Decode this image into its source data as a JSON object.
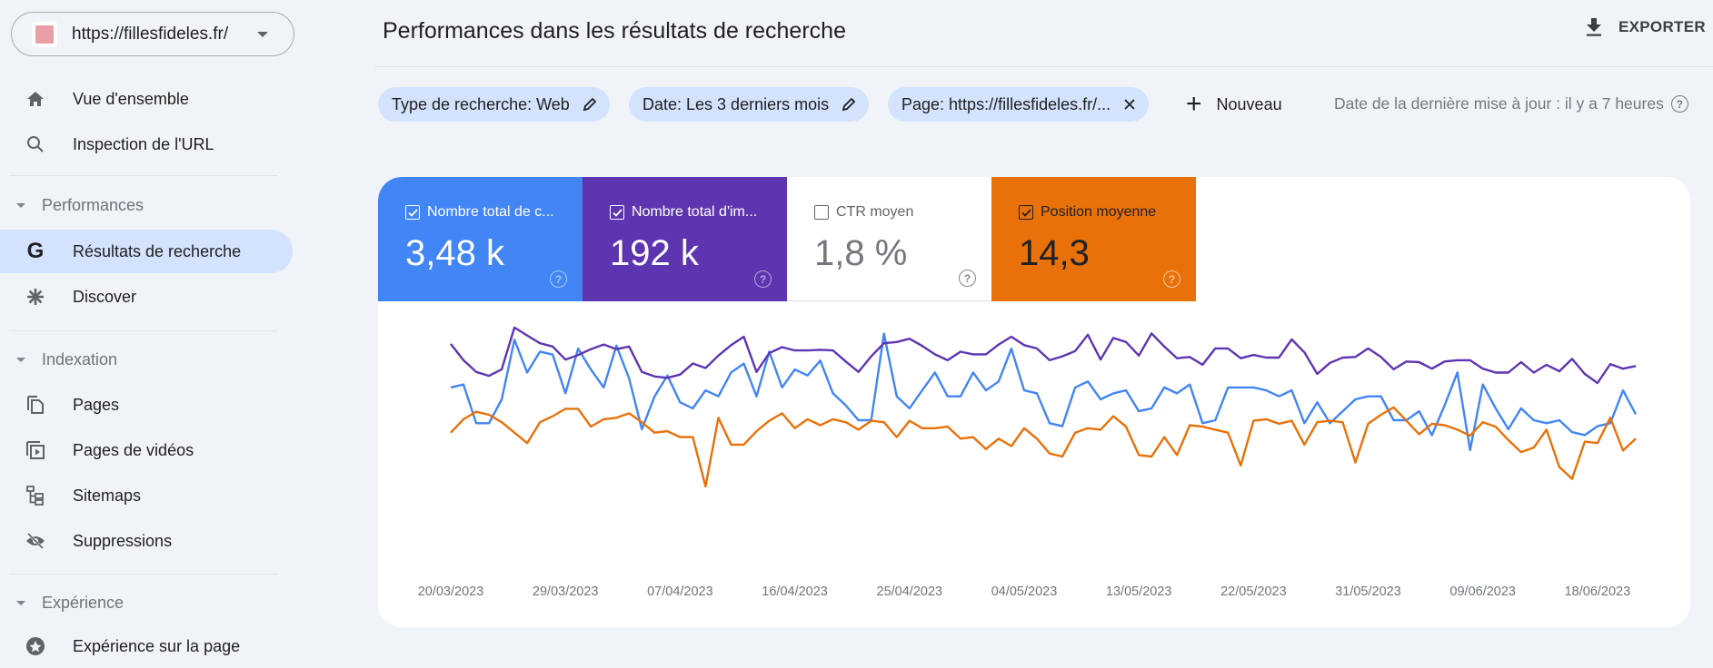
{
  "sidebar": {
    "property_url": "https://fillesfideles.fr/",
    "items_top": [
      {
        "label": "Vue d'ensemble",
        "icon": "home-icon"
      },
      {
        "label": "Inspection de l'URL",
        "icon": "search-icon"
      }
    ],
    "sections": [
      {
        "label": "Performances",
        "items": [
          {
            "label": "Résultats de recherche",
            "icon": "google-g-icon",
            "active": true
          },
          {
            "label": "Discover",
            "icon": "asterisk-icon"
          }
        ]
      },
      {
        "label": "Indexation",
        "items": [
          {
            "label": "Pages",
            "icon": "pages-icon"
          },
          {
            "label": "Pages de vidéos",
            "icon": "video-pages-icon"
          },
          {
            "label": "Sitemaps",
            "icon": "sitemap-icon"
          },
          {
            "label": "Suppressions",
            "icon": "eye-off-icon"
          }
        ]
      },
      {
        "label": "Expérience",
        "items": [
          {
            "label": "Expérience sur la page",
            "icon": "page-experience-icon"
          }
        ]
      }
    ]
  },
  "header": {
    "title": "Performances dans les résultats de recherche",
    "export_label": "EXPORTER"
  },
  "filters": {
    "chips": [
      {
        "label": "Type de recherche: Web",
        "action": "edit"
      },
      {
        "label": "Date: Les 3 derniers mois",
        "action": "edit"
      },
      {
        "label": "Page: https://fillesfideles.fr/...",
        "action": "remove"
      }
    ],
    "new_label": "Nouveau",
    "last_update": "Date de la dernière mise à jour : il y a 7 heures"
  },
  "metrics": [
    {
      "label": "Nombre total de c...",
      "value": "3,48 k",
      "checked": true,
      "color": "#4285f4"
    },
    {
      "label": "Nombre total d'im...",
      "value": "192 k",
      "checked": true,
      "color": "#5e35b1"
    },
    {
      "label": "CTR moyen",
      "value": "1,8 %",
      "checked": false,
      "color": "#ffffff"
    },
    {
      "label": "Position moyenne",
      "value": "14,3",
      "checked": true,
      "color": "#e8710a"
    }
  ],
  "chart_data": {
    "type": "line",
    "title": "",
    "xlabel": "",
    "ylabel": "",
    "grid": false,
    "legend": "none",
    "start_date": "20/03/2023",
    "tick_labels": [
      "20/03/2023",
      "29/03/2023",
      "07/04/2023",
      "16/04/2023",
      "25/04/2023",
      "04/05/2023",
      "13/05/2023",
      "22/05/2023",
      "31/05/2023",
      "09/06/2023",
      "18/06/2023"
    ],
    "tick_every_days": 9,
    "series": [
      {
        "name": "Clics",
        "color": "#4285f4",
        "ylim": [
          0,
          70
        ],
        "values": [
          39,
          40,
          27,
          27,
          35,
          55,
          44,
          51,
          50,
          37,
          52,
          45,
          39,
          53,
          42,
          25,
          36,
          43,
          34,
          32,
          38,
          36,
          44,
          47,
          36,
          51,
          39,
          45,
          43,
          48,
          37,
          33,
          28,
          28,
          57,
          36,
          32,
          38,
          44,
          36,
          36,
          44,
          38,
          41,
          52,
          38,
          37,
          27,
          26,
          39,
          41,
          35,
          37,
          38,
          31,
          32,
          39,
          37,
          40,
          27,
          28,
          39,
          39,
          39,
          38,
          36,
          38,
          27,
          34,
          27,
          31,
          35,
          36,
          36,
          28,
          28,
          31,
          23,
          33,
          44,
          18,
          40,
          32,
          25,
          32,
          28,
          27,
          28,
          24,
          23,
          26,
          27,
          38,
          30
        ]
      },
      {
        "name": "Impressions",
        "color": "#5e35b1",
        "ylim": [
          0,
          3200
        ],
        "values": [
          2450,
          2200,
          2020,
          1960,
          2060,
          2700,
          2580,
          2460,
          2410,
          2210,
          2280,
          2370,
          2440,
          2370,
          2410,
          2020,
          1950,
          1930,
          1980,
          2150,
          2080,
          2270,
          2430,
          2560,
          2020,
          2310,
          2400,
          2350,
          2350,
          2360,
          2350,
          2180,
          2020,
          2260,
          2460,
          2480,
          2530,
          2420,
          2290,
          2200,
          2330,
          2290,
          2290,
          2440,
          2560,
          2430,
          2380,
          2200,
          2260,
          2340,
          2590,
          2210,
          2540,
          2480,
          2270,
          2610,
          2410,
          2230,
          2250,
          2130,
          2380,
          2380,
          2230,
          2280,
          2240,
          2240,
          2520,
          2320,
          1990,
          2160,
          2240,
          2250,
          2380,
          2250,
          2060,
          2180,
          2170,
          2070,
          2180,
          2200,
          2200,
          2070,
          2010,
          2010,
          2170,
          2010,
          2130,
          2030,
          2220,
          1990,
          1850,
          2140,
          2070,
          2110
        ]
      },
      {
        "name": "Position",
        "color": "#e8710a",
        "ylim_inverted": [
          8,
          22
        ],
        "values": [
          14.8,
          13.9,
          13.4,
          13.6,
          14.1,
          14.8,
          15.5,
          14.1,
          13.7,
          13.2,
          13.2,
          14.4,
          13.9,
          13.8,
          13.5,
          14.1,
          14.8,
          14.7,
          15.1,
          15.1,
          18.4,
          13.8,
          15.6,
          15.6,
          14.7,
          14.0,
          13.5,
          14.5,
          13.9,
          14.3,
          13.9,
          14.1,
          14.6,
          14.0,
          14.1,
          15.1,
          14.0,
          14.5,
          14.5,
          14.4,
          15.2,
          15.1,
          15.9,
          15.2,
          15.7,
          14.5,
          15.2,
          16.2,
          16.4,
          14.8,
          14.5,
          14.6,
          13.7,
          14.4,
          16.3,
          16.4,
          15.1,
          16.3,
          14.3,
          14.4,
          14.6,
          14.8,
          17.0,
          14.0,
          13.9,
          14.2,
          14.0,
          15.6,
          14.1,
          14.0,
          14.1,
          16.8,
          14.2,
          13.6,
          13.1,
          14.0,
          14.9,
          14.2,
          14.3,
          14.6,
          15.0,
          14.1,
          14.4,
          15.3,
          16.1,
          15.8,
          14.6,
          17.1,
          17.9,
          15.4,
          15.5,
          13.8,
          16.0,
          15.2
        ]
      }
    ]
  }
}
